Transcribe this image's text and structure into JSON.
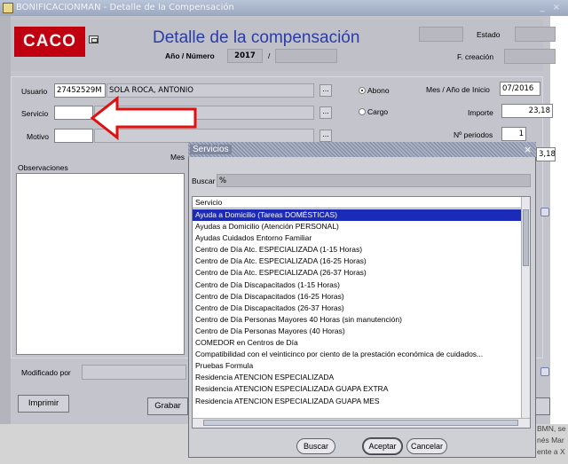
{
  "window": {
    "title": "BONIFICACIONMAN - Detalle de la Compensación"
  },
  "header": {
    "logo": "CACO",
    "title": "Detalle de la compensación",
    "anio_label": "Año / Número",
    "anio_value": "2017",
    "separator": "/",
    "estado_label": "Estado",
    "fcreacion_label": "F. creación"
  },
  "form": {
    "usuario_label": "Usuario",
    "usuario_code": "27452529M",
    "usuario_name": "SOLA ROCA, ANTONIO",
    "servicio_label": "Servicio",
    "motivo_label": "Motivo",
    "mes_label": "Mes",
    "observaciones_label": "Observaciones",
    "abono_label": "Abono",
    "cargo_label": "Cargo",
    "mes_inicio_label": "Mes / Año de Inicio",
    "mes_inicio_value": "07/2016",
    "importe_label": "Importe",
    "importe_value": "23,18",
    "periodos_label": "Nº periodos",
    "periodos_value": "1",
    "side_value": "3,18",
    "modificado_label": "Modificado por",
    "dots": "..."
  },
  "buttons": {
    "imprimir": "Imprimir",
    "grabar": "Grabar"
  },
  "dialog": {
    "title": "Servicios",
    "close": "×",
    "buscar_label": "Buscar",
    "buscar_value": "%",
    "column": "Servicio",
    "items": [
      "Ayuda a Domicilio (Tareas DOMÉSTICAS)",
      "Ayudas a Domicilio (Atención PERSONAL)",
      "Ayudas Cuidados Entorno Familiar",
      "Centro de  Día Atc. ESPECIALIZADA (1-15 Horas)",
      "Centro de  Día Atc. ESPECIALIZADA (16-25 Horas)",
      "Centro de  Día Atc. ESPECIALIZADA (26-37 Horas)",
      "Centro de Día Discapacitados (1-15 Horas)",
      "Centro de Día Discapacitados (16-25 Horas)",
      "Centro de Día Discapacitados (26-37 Horas)",
      "Centro de Día Personas  Mayores 40 Horas (sin manutención)",
      "Centro de Día Personas Mayores (40 Horas)",
      "COMEDOR en Centros de Día",
      "Compatibilidad con el veinticinco por ciento de la prestación económica de cuidados...",
      "Pruebas Formula",
      "Residencia ATENCION ESPECIALIZADA",
      "Residencia ATENCION ESPECIALIZADA GUAPA EXTRA",
      "Residencia ATENCION ESPECIALIZADA GUAPA MES"
    ],
    "selected_index": 0,
    "btn_buscar": "Buscar",
    "btn_aceptar": "Aceptar",
    "btn_cancelar": "Cancelar"
  },
  "background": {
    "line1": "BMN, se",
    "line2": "nés Mar",
    "line3": "ente a X"
  },
  "colors": {
    "title_blue": "#2a3ca8",
    "logo_red": "#c00010",
    "selection": "#1c2ab8",
    "arrow": "#e01010"
  }
}
